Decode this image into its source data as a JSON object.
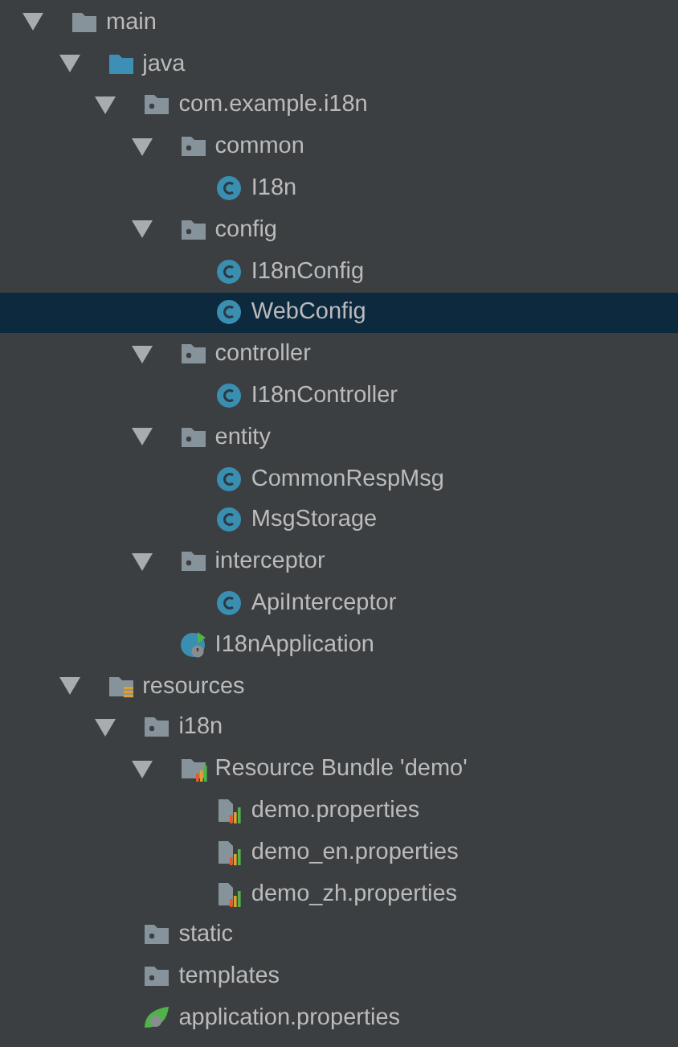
{
  "tree": [
    {
      "label": "main",
      "kind": "folder",
      "expanded": true,
      "selected": false,
      "children": [
        {
          "label": "java",
          "kind": "source-folder",
          "expanded": true,
          "selected": false,
          "children": [
            {
              "label": "com.example.i18n",
              "kind": "package",
              "expanded": true,
              "selected": false,
              "children": [
                {
                  "label": "common",
                  "kind": "package",
                  "expanded": true,
                  "selected": false,
                  "children": [
                    {
                      "label": "I18n",
                      "kind": "class",
                      "selected": false
                    }
                  ]
                },
                {
                  "label": "config",
                  "kind": "package",
                  "expanded": true,
                  "selected": false,
                  "children": [
                    {
                      "label": "I18nConfig",
                      "kind": "class",
                      "selected": false
                    },
                    {
                      "label": "WebConfig",
                      "kind": "class",
                      "selected": true
                    }
                  ]
                },
                {
                  "label": "controller",
                  "kind": "package",
                  "expanded": true,
                  "selected": false,
                  "children": [
                    {
                      "label": "I18nController",
                      "kind": "class",
                      "selected": false
                    }
                  ]
                },
                {
                  "label": "entity",
                  "kind": "package",
                  "expanded": true,
                  "selected": false,
                  "children": [
                    {
                      "label": "CommonRespMsg",
                      "kind": "class",
                      "selected": false
                    },
                    {
                      "label": "MsgStorage",
                      "kind": "class",
                      "selected": false
                    }
                  ]
                },
                {
                  "label": "interceptor",
                  "kind": "package",
                  "expanded": true,
                  "selected": false,
                  "children": [
                    {
                      "label": "ApiInterceptor",
                      "kind": "class",
                      "selected": false
                    }
                  ]
                },
                {
                  "label": "I18nApplication",
                  "kind": "app-class",
                  "selected": false
                }
              ]
            }
          ]
        },
        {
          "label": "resources",
          "kind": "resources-folder",
          "expanded": true,
          "selected": false,
          "children": [
            {
              "label": "i18n",
              "kind": "package",
              "expanded": true,
              "selected": false,
              "children": [
                {
                  "label": "Resource Bundle 'demo'",
                  "kind": "bundle",
                  "expanded": true,
                  "selected": false,
                  "children": [
                    {
                      "label": "demo.properties",
                      "kind": "properties",
                      "selected": false
                    },
                    {
                      "label": "demo_en.properties",
                      "kind": "properties",
                      "selected": false
                    },
                    {
                      "label": "demo_zh.properties",
                      "kind": "properties",
                      "selected": false
                    }
                  ]
                }
              ]
            },
            {
              "label": "static",
              "kind": "package",
              "selected": false
            },
            {
              "label": "templates",
              "kind": "package",
              "selected": false
            },
            {
              "label": "application.properties",
              "kind": "spring-properties",
              "selected": false
            }
          ]
        }
      ]
    }
  ]
}
